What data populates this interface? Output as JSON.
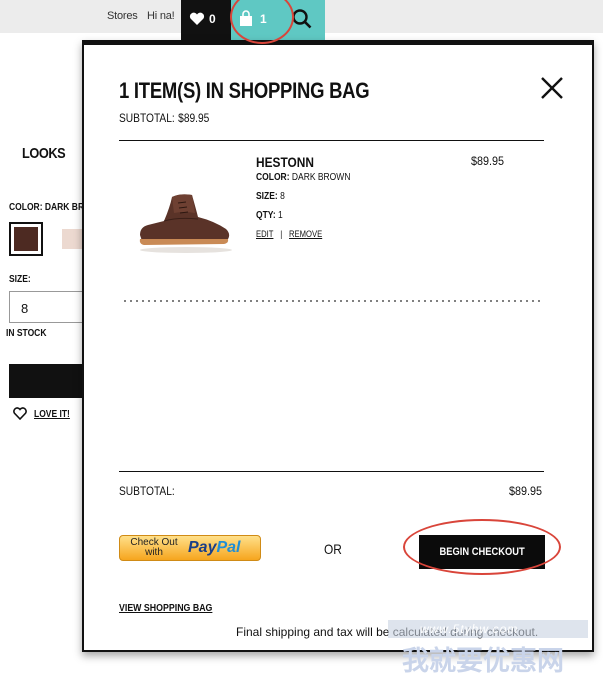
{
  "header": {
    "links": [
      "Stores",
      "Hi na!"
    ],
    "wishlist_count": "0",
    "bag_count": "1"
  },
  "product_page": {
    "looks_label": "LOOKS",
    "color_label": "COLOR: DARK BRO",
    "size_label": "SIZE:",
    "size_value": "8",
    "stock_label": "IN STOCK",
    "love_label": "LOVE IT!"
  },
  "bag": {
    "title": "1 ITEM(S) IN SHOPPING BAG",
    "subtotal_label": "SUBTOTAL:",
    "subtotal_value": "$89.95",
    "item": {
      "name": "HESTONN",
      "price": "$89.95",
      "color_label": "COLOR:",
      "color_value": "DARK BROWN",
      "size_label": "SIZE:",
      "size_value": "8",
      "qty_label": "QTY:",
      "qty_value": "1",
      "edit_label": "EDIT",
      "separator": "|",
      "remove_label": "REMOVE"
    },
    "footer_subtotal_label": "SUBTOTAL:",
    "footer_subtotal_value": "$89.95",
    "paypal_small": "Check Out with",
    "paypal_logo_a": "Pay",
    "paypal_logo_b": "Pal",
    "or_label": "OR",
    "checkout_label": "BEGIN CHECKOUT",
    "view_bag_label": "VIEW SHOPPING BAG",
    "shipping_note": "Final shipping and tax will be calculated during checkout."
  },
  "watermark": {
    "url": "www.5tyhw.com",
    "cn": "我就要优惠网"
  },
  "colors": {
    "accent": "#5fc8c3",
    "annotation_red": "#d9453a",
    "swatch_dark_brown": "#4d2a22",
    "swatch_light": "#ecd9d0"
  }
}
